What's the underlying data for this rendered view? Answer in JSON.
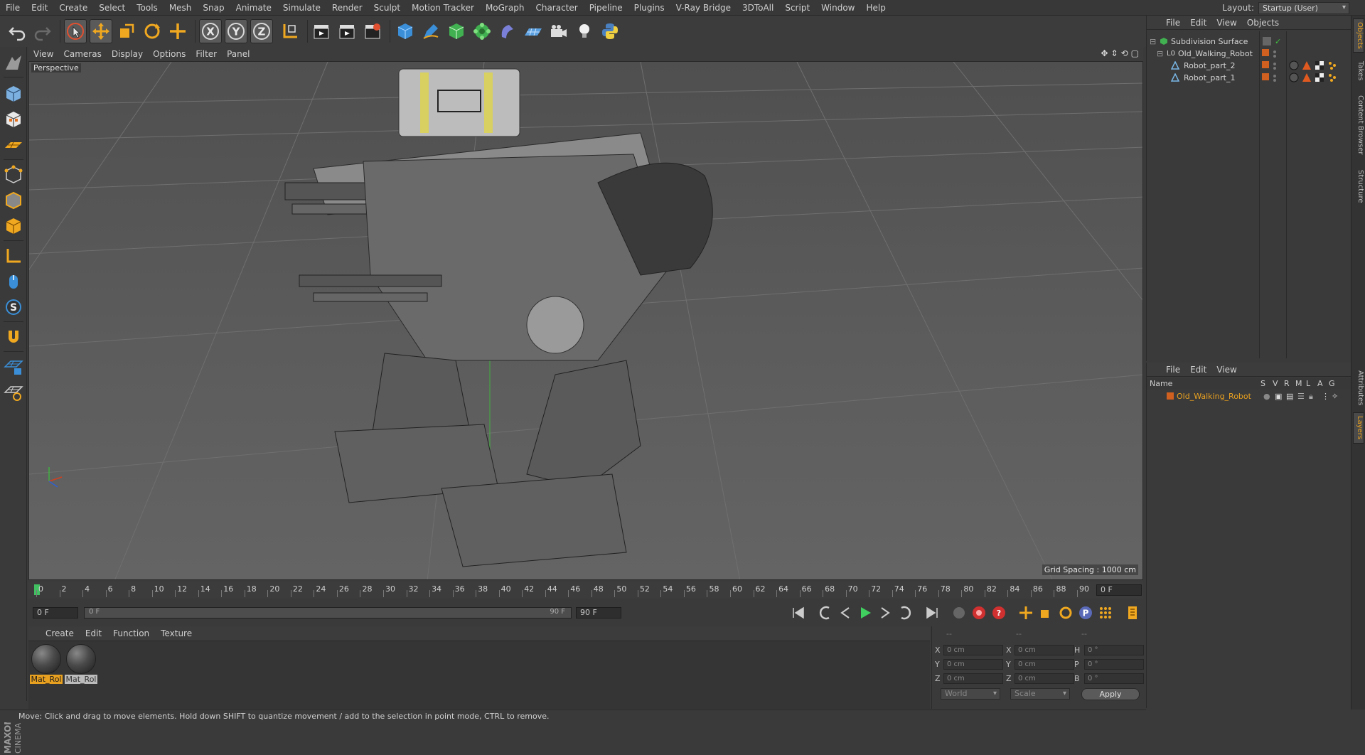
{
  "menu": {
    "items": [
      "File",
      "Edit",
      "Create",
      "Select",
      "Tools",
      "Mesh",
      "Snap",
      "Animate",
      "Simulate",
      "Render",
      "Sculpt",
      "Motion Tracker",
      "MoGraph",
      "Character",
      "Pipeline",
      "Plugins",
      "V-Ray Bridge",
      "3DToAll",
      "Script",
      "Window",
      "Help"
    ],
    "layout_label": "Layout:",
    "layout_value": "Startup (User)"
  },
  "viewport": {
    "menu": [
      "View",
      "Cameras",
      "Display",
      "Options",
      "Filter",
      "Panel"
    ],
    "camera_label": "Perspective",
    "grid_spacing": "Grid Spacing : 1000 cm"
  },
  "timeline": {
    "ticks": [
      "0",
      "2",
      "4",
      "6",
      "8",
      "10",
      "12",
      "14",
      "16",
      "18",
      "20",
      "22",
      "24",
      "26",
      "28",
      "30",
      "32",
      "34",
      "36",
      "38",
      "40",
      "42",
      "44",
      "46",
      "48",
      "50",
      "52",
      "54",
      "56",
      "58",
      "60",
      "62",
      "64",
      "66",
      "68",
      "70",
      "72",
      "74",
      "76",
      "78",
      "80",
      "82",
      "84",
      "86",
      "88",
      "90"
    ],
    "current_frame": "0 F",
    "start_field": "0 F",
    "range_start": "0 F",
    "range_end": "90 F",
    "end_field": "90 F"
  },
  "material_panel": {
    "menu": [
      "Create",
      "Edit",
      "Function",
      "Texture"
    ],
    "materials": [
      {
        "label": "Mat_Rol",
        "active": true
      },
      {
        "label": "Mat_Rol",
        "active": false
      }
    ]
  },
  "coordinates": {
    "header": [
      "--",
      "--",
      "--"
    ],
    "rows": [
      {
        "a_label": "X",
        "a_value": "0 cm",
        "b_label": "X",
        "b_value": "0 cm",
        "c_label": "H",
        "c_value": "0 °"
      },
      {
        "a_label": "Y",
        "a_value": "0 cm",
        "b_label": "Y",
        "b_value": "0 cm",
        "c_label": "P",
        "c_value": "0 °"
      },
      {
        "a_label": "Z",
        "a_value": "0 cm",
        "b_label": "Z",
        "b_value": "0 cm",
        "c_label": "B",
        "c_value": "0 °"
      }
    ],
    "space": "World",
    "mode": "Scale",
    "apply": "Apply"
  },
  "status": "Move: Click and drag to move elements. Hold down SHIFT to quantize movement / add to the selection in point mode, CTRL to remove.",
  "object_manager": {
    "menu": [
      "File",
      "Edit",
      "View",
      "Objects"
    ],
    "tree": [
      {
        "name": "Subdivision Surface",
        "level": 0,
        "icon": "subdivision-icon"
      },
      {
        "name": "Old_Walking_Robot",
        "level": 1,
        "icon": "null-icon"
      },
      {
        "name": "Robot_part_2",
        "level": 2,
        "icon": "polygon-icon"
      },
      {
        "name": "Robot_part_1",
        "level": 2,
        "icon": "polygon-icon"
      }
    ]
  },
  "layer_manager": {
    "menu": [
      "File",
      "Edit",
      "View"
    ],
    "columns": [
      "Name",
      "S",
      "V",
      "R",
      "M",
      "L",
      "A",
      "G"
    ],
    "layers": [
      {
        "name": "Old_Walking_Robot"
      }
    ]
  },
  "side_tabs": {
    "top": [
      "Objects",
      "Takes",
      "Content Browser",
      "Structure"
    ],
    "bottom": [
      "Attributes",
      "Layers"
    ]
  },
  "branding": "MAXON CINEMA 4D",
  "colors": {
    "accent": "#e8a020",
    "bg": "#3a3a3a",
    "panel": "#3c3c3c"
  }
}
